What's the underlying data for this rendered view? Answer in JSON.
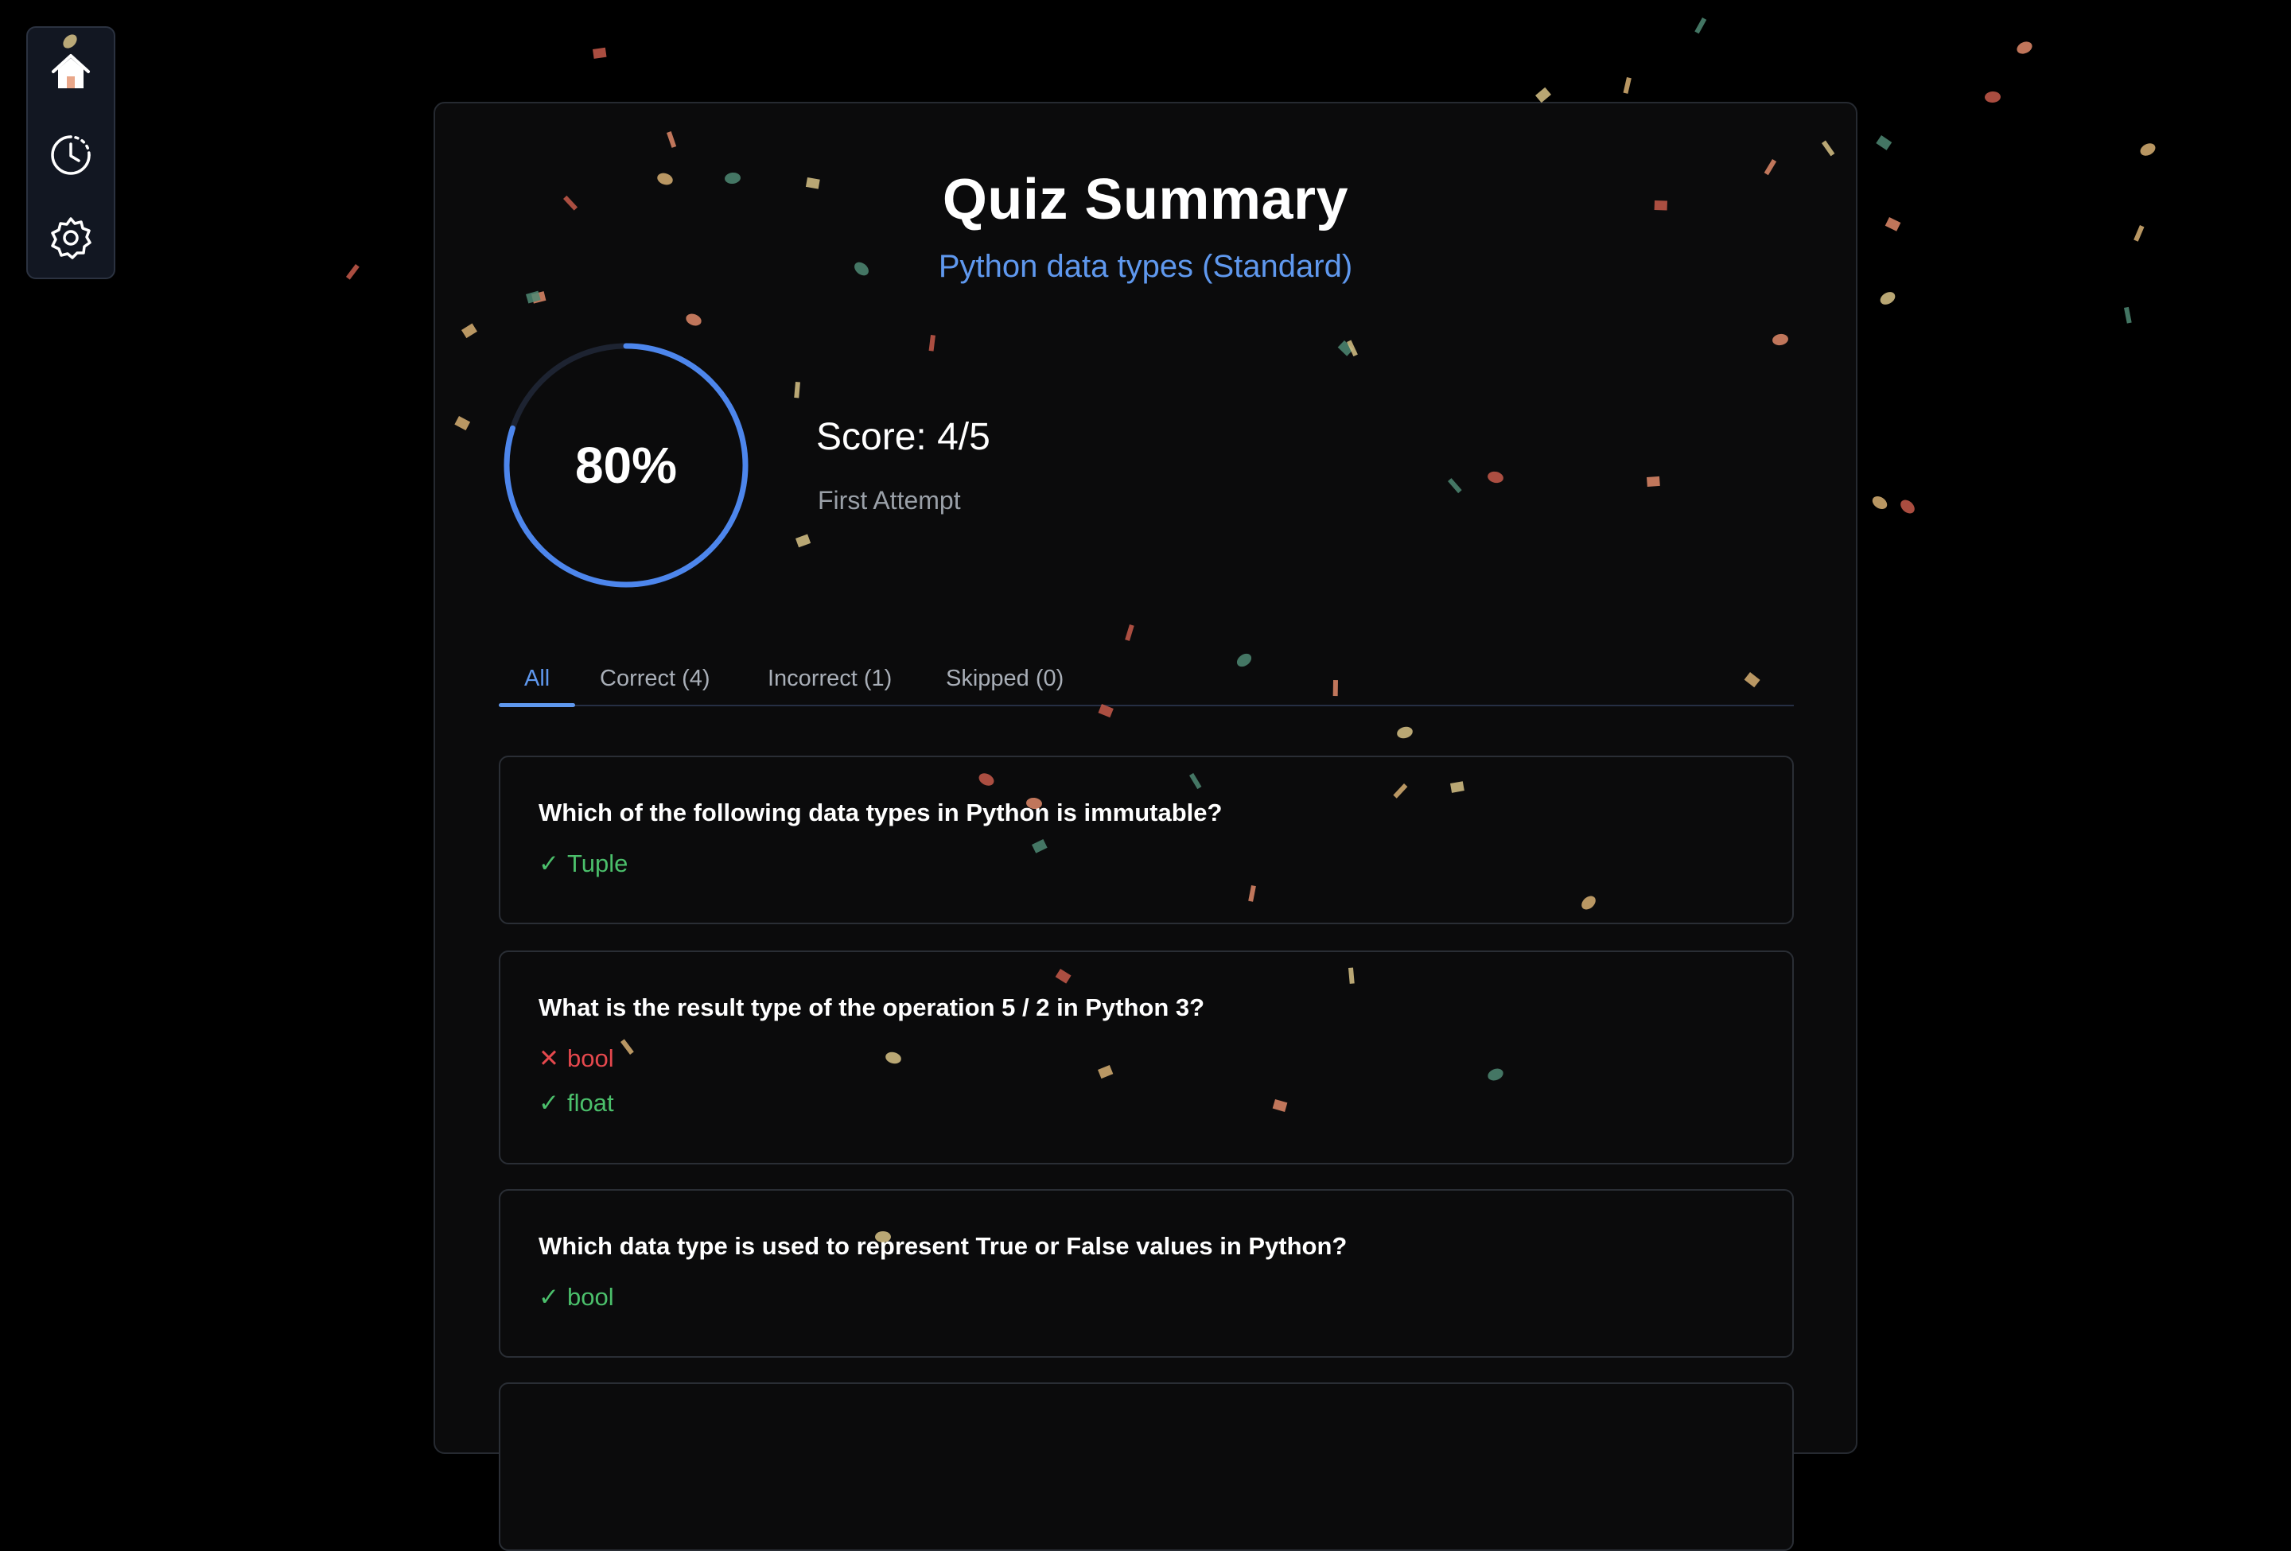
{
  "sidebar": {
    "items": [
      {
        "name": "home",
        "icon": "home-icon"
      },
      {
        "name": "history",
        "icon": "history-clock-icon"
      },
      {
        "name": "settings",
        "icon": "gear-icon"
      }
    ]
  },
  "summary": {
    "title": "Quiz Summary",
    "subtitle": "Python data types (Standard)",
    "percent_label": "80%",
    "percent_value": 0.8,
    "score_label": "Score: 4/5",
    "attempt_label": "First Attempt"
  },
  "tabs": [
    {
      "label": "All",
      "active": true
    },
    {
      "label": "Correct (4)",
      "active": false
    },
    {
      "label": "Incorrect (1)",
      "active": false
    },
    {
      "label": "Skipped (0)",
      "active": false
    }
  ],
  "questions": [
    {
      "text": "Which of the following data types in Python is immutable?",
      "answers": [
        {
          "status": "correct",
          "mark": "✓",
          "text": "Tuple"
        }
      ]
    },
    {
      "text": "What is the result type of the operation 5 / 2 in Python 3?",
      "answers": [
        {
          "status": "wrong",
          "mark": "✕",
          "text": "bool"
        },
        {
          "status": "correct",
          "mark": "✓",
          "text": "float"
        }
      ]
    },
    {
      "text": "Which data type is used to represent True or False values in Python?",
      "answers": [
        {
          "status": "correct",
          "mark": "✓",
          "text": "bool"
        }
      ]
    }
  ],
  "colors": {
    "accent": "#5f98ee",
    "correct": "#4bbf6b",
    "wrong": "#e5484d",
    "confetti": [
      "#d8c387",
      "#c85a4b",
      "#4f8a74",
      "#e08a6a",
      "#d8b073"
    ]
  }
}
